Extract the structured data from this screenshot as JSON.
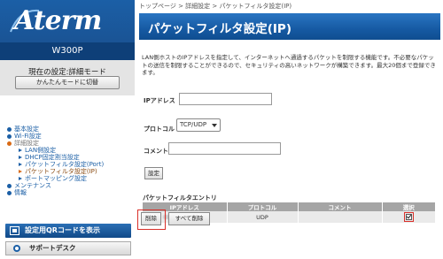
{
  "brand": {
    "logo": "Aterm",
    "model": "W300P"
  },
  "mode": {
    "current": "現在の設定:詳細モード",
    "switch_button": "かんたんモードに切替"
  },
  "menu": {
    "items": [
      {
        "label": "基本設定"
      },
      {
        "label": "Wi-Fi設定"
      },
      {
        "label": "詳細設定"
      },
      {
        "label": "LAN側設定"
      },
      {
        "label": "DHCP固定割当設定"
      },
      {
        "label": "パケットフィルタ設定(Port)"
      },
      {
        "label": "パケットフィルタ設定(IP)"
      },
      {
        "label": "ポートマッピング設定"
      },
      {
        "label": "メンテナンス"
      },
      {
        "label": "情報"
      }
    ]
  },
  "sidebar_buttons": {
    "qr": "設定用QRコードを表示",
    "support": "サポートデスク"
  },
  "breadcrumb": "トップページ > 詳細設定 > パケットフィルタ設定(IP)",
  "page_title": "パケットフィルタ設定(IP)",
  "description": "LAN側ホストのIPアドレスを指定して、インターネットへ通過するパケットを制限する機能です。不必要なパケットの送信を制限することができるので、セキュリティの高いネットワークが構築できます。最大20個まで登録できます。",
  "form": {
    "ip_label": "IPアドレス",
    "ip_value": "",
    "protocol_label": "プロトコル",
    "protocol_selected": "TCP/UDP",
    "comment_label": "コメント",
    "comment_value": "",
    "set_button": "設定"
  },
  "entries": {
    "title": "パケットフィルタエントリ",
    "headers": [
      "IPアドレス",
      "プロトコル",
      "コメント",
      "選択"
    ],
    "rows": [
      {
        "ip": "",
        "protocol": "UDP",
        "comment": "",
        "selected": true
      }
    ]
  },
  "actions": {
    "delete": "削除",
    "delete_all": "すべて削除"
  },
  "colors": {
    "brand_blue": "#1b5fa6",
    "highlight_red": "#d9302a"
  }
}
